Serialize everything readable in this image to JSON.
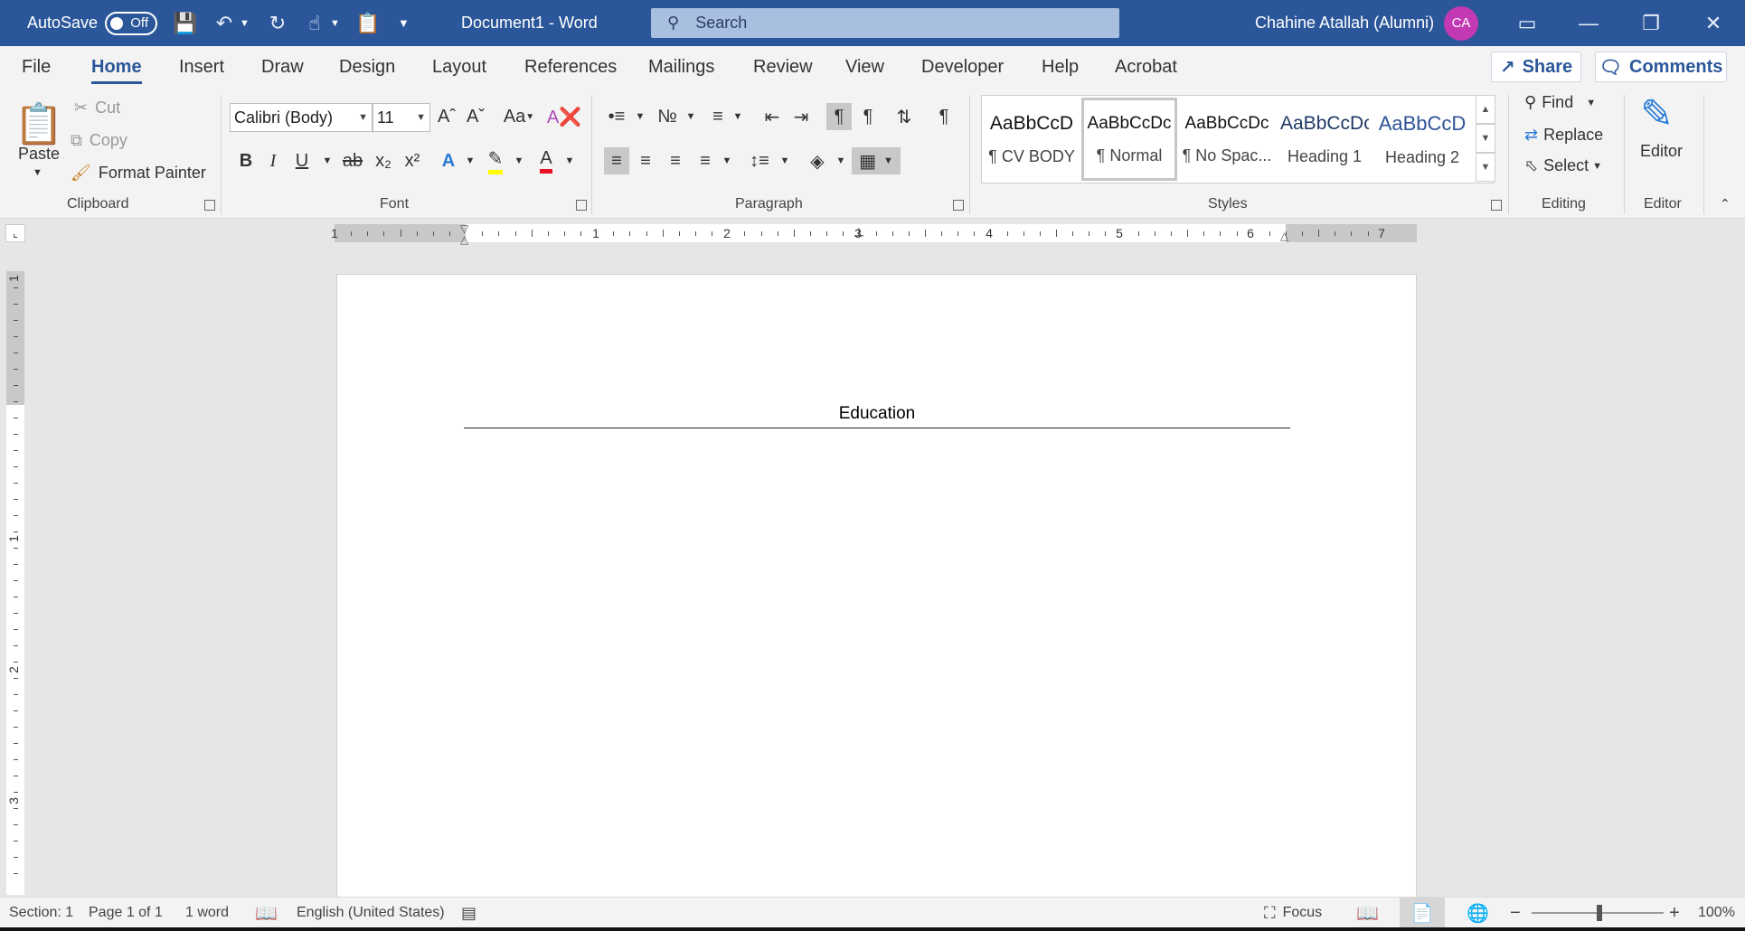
{
  "titlebar": {
    "autosave_label": "AutoSave",
    "autosave_state": "Off",
    "doc_title": "Document1  -  Word",
    "search_placeholder": "Search",
    "user_name": "Chahine Atallah (Alumni)",
    "user_initials": "CA"
  },
  "tabs": [
    "File",
    "Home",
    "Insert",
    "Draw",
    "Design",
    "Layout",
    "References",
    "Mailings",
    "Review",
    "View",
    "Developer",
    "Help",
    "Acrobat"
  ],
  "share_label": "Share",
  "comments_label": "Comments",
  "clipboard": {
    "paste": "Paste",
    "cut": "Cut",
    "copy": "Copy",
    "format_painter": "Format Painter",
    "group": "Clipboard"
  },
  "font": {
    "name": "Calibri (Body)",
    "size": "11",
    "group": "Font",
    "highlight_color": "#ffff00",
    "font_color": "#e81123"
  },
  "paragraph": {
    "group": "Paragraph"
  },
  "styles": {
    "group": "Styles",
    "items": [
      {
        "sample": "AaBbCcD",
        "name": "¶ CV BODY"
      },
      {
        "sample": "AaBbCcDc",
        "name": "¶ Normal"
      },
      {
        "sample": "AaBbCcDc",
        "name": "¶ No Spac..."
      },
      {
        "sample": "AaBbCcDc",
        "name": "Heading 1"
      },
      {
        "sample": "AaBbCcD",
        "name": "Heading 2"
      }
    ]
  },
  "editing": {
    "find": "Find",
    "replace": "Replace",
    "select": "Select",
    "group": "Editing"
  },
  "editor": {
    "label": "Editor",
    "group": "Editor"
  },
  "ruler": {
    "h_numbers": [
      "1",
      "1",
      "2",
      "3",
      "4",
      "5",
      "6",
      "7"
    ],
    "v_numbers": [
      "1",
      "1",
      "2",
      "3"
    ]
  },
  "document": {
    "heading": "Education"
  },
  "status": {
    "section": "Section: 1",
    "page": "Page 1 of 1",
    "words": "1 word",
    "language": "English (United States)",
    "focus": "Focus",
    "zoom": "100%"
  }
}
